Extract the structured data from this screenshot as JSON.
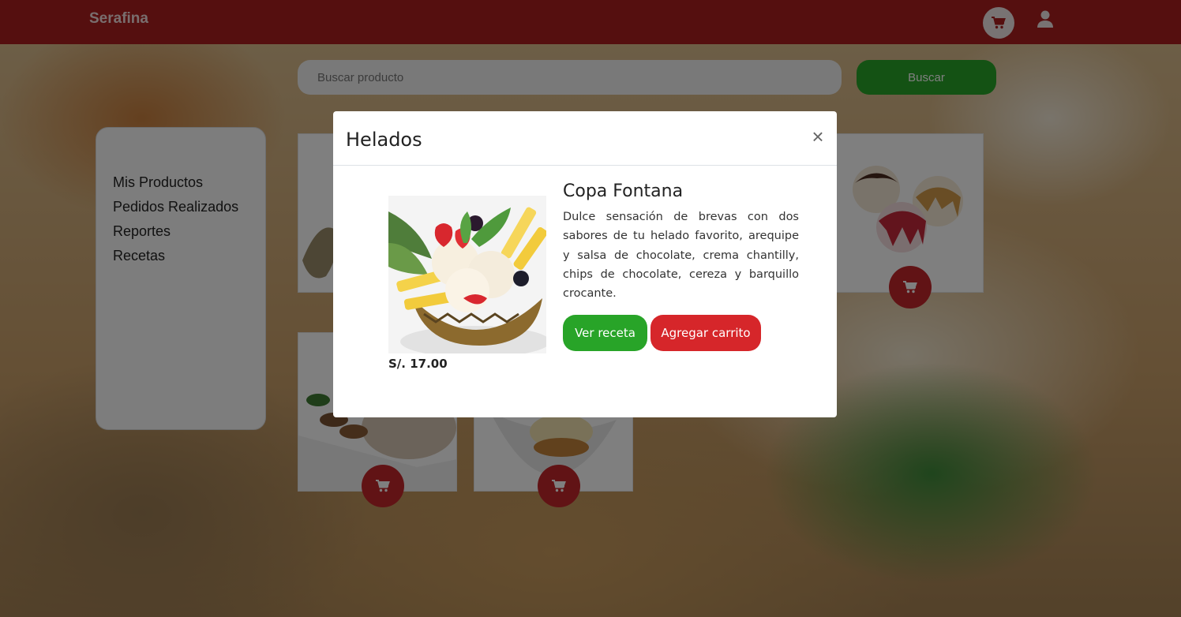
{
  "navbar": {
    "brand": "Serafina",
    "cart_icon": "cart-icon",
    "user_icon": "user-icon"
  },
  "search": {
    "placeholder": "Buscar producto",
    "button_label": "Buscar"
  },
  "sidebar": {
    "items": [
      {
        "label": "Mis Productos"
      },
      {
        "label": "Pedidos Realizados"
      },
      {
        "label": "Reportes"
      },
      {
        "label": "Recetas"
      }
    ]
  },
  "products_grid": {
    "cart_icon": "cart-icon"
  },
  "modal": {
    "title": "Helados",
    "close_label": "×",
    "product": {
      "name": "Copa Fontana",
      "description": "Dulce sensación de brevas con dos sabores de tu helado favorito, arequipe y salsa de chocolate, crema chantilly, chips de chocolate, cereza y barquillo crocante.",
      "price": "S/. 17.00"
    },
    "buttons": {
      "recipe": "Ver receta",
      "add_to_cart": "Agregar carrito"
    }
  },
  "colors": {
    "navbar": "#ab1f1f",
    "primary_green": "#28a428",
    "primary_red": "#d6262a"
  }
}
